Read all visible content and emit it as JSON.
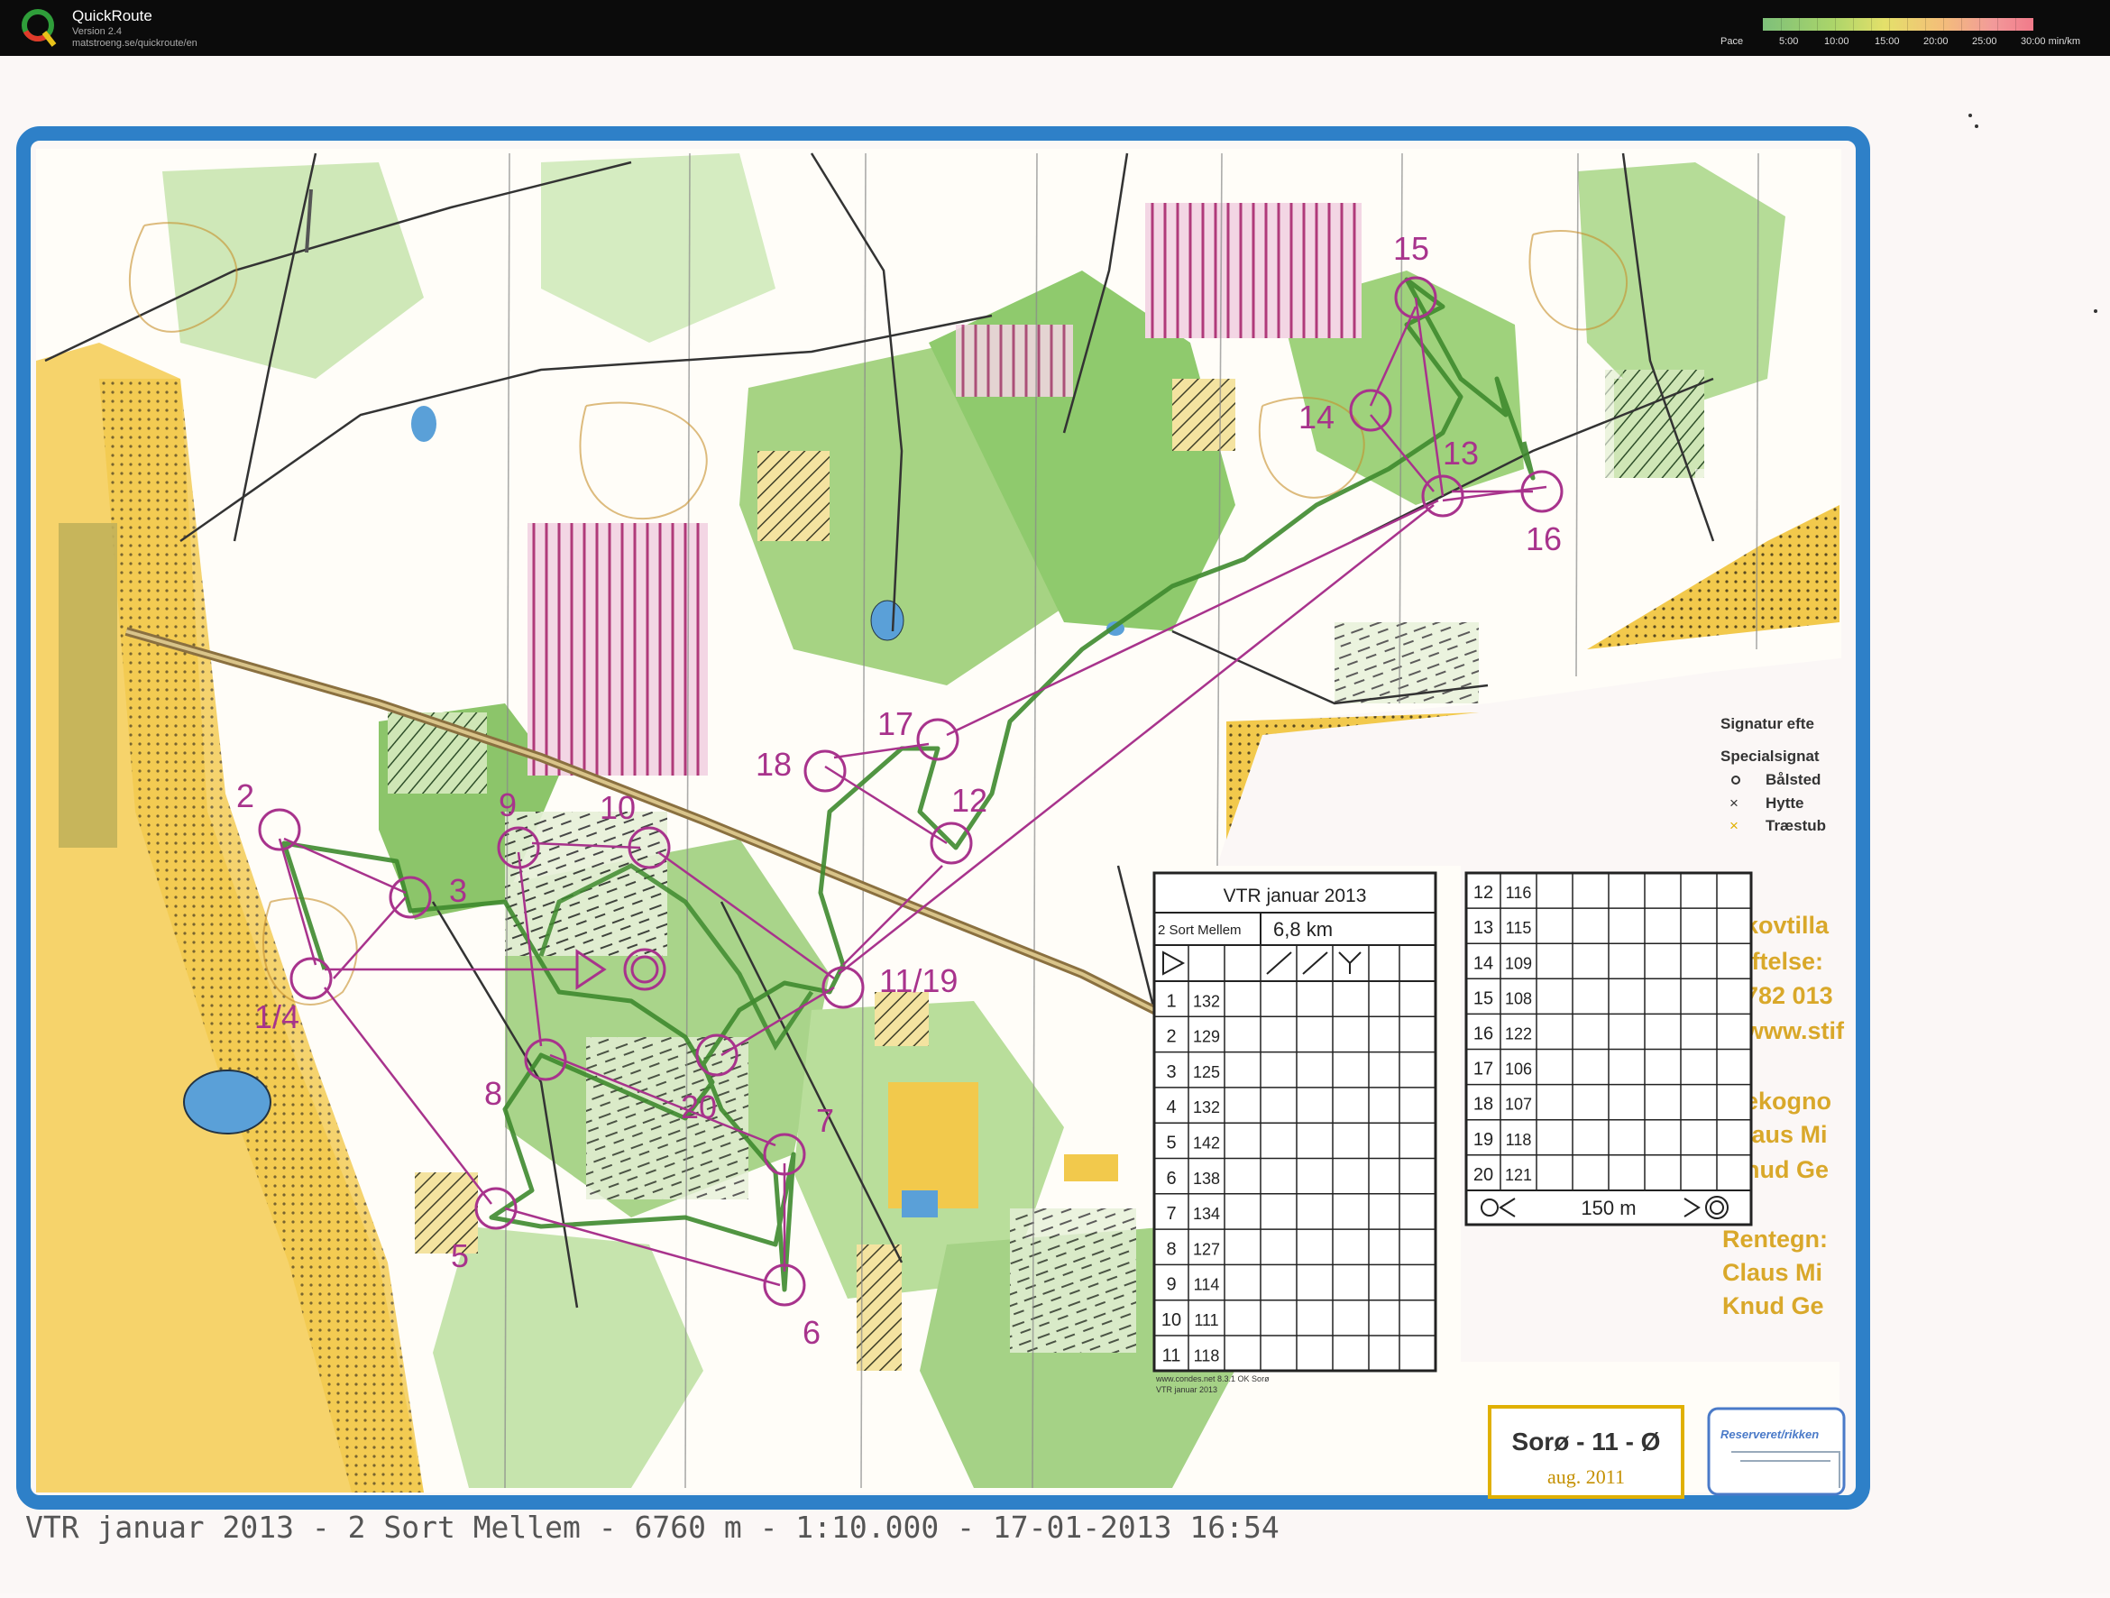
{
  "app": {
    "name": "QuickRoute",
    "version": "Version 2.4",
    "url": "matstroeng.se/quickroute/en"
  },
  "pace": {
    "label": "Pace",
    "ticks": [
      "5:00",
      "10:00",
      "15:00",
      "20:00",
      "25:00",
      "30:00 min/km"
    ]
  },
  "controls": {
    "c2": "2",
    "c3": "3",
    "c14": "1/4",
    "c5": "5",
    "c6": "6",
    "c7": "7",
    "c8": "8",
    "c9": "9",
    "c10": "10",
    "c1119": "11/19",
    "c12": "12",
    "c13": "13",
    "c14b": "14",
    "c15": "15",
    "c16": "16",
    "c17": "17",
    "c18": "18",
    "c20": "20"
  },
  "legend": {
    "title": "Signatur efte",
    "subtitle": "Specialsignat",
    "items": [
      "Bålsted",
      "Hytte",
      "Træstub"
    ]
  },
  "side_text": [
    "kovtilla",
    "iftelse:",
    "782 013",
    "www.stif",
    "ekogno",
    "laus Mi",
    "nud Ge",
    "Rentegn:",
    "Claus Mi",
    "Knud Ge"
  ],
  "descriptions": {
    "title": "VTR januar 2013",
    "class": "2 Sort Mellem",
    "length": "6,8 km",
    "left_rows": [
      [
        "1",
        "132"
      ],
      [
        "2",
        "129"
      ],
      [
        "3",
        "125"
      ],
      [
        "4",
        "132"
      ],
      [
        "5",
        "142"
      ],
      [
        "6",
        "138"
      ],
      [
        "7",
        "134"
      ],
      [
        "8",
        "127"
      ],
      [
        "9",
        "114"
      ],
      [
        "10",
        "111"
      ],
      [
        "11",
        "118"
      ]
    ],
    "right_rows": [
      [
        "12",
        "116"
      ],
      [
        "13",
        "115"
      ],
      [
        "14",
        "109"
      ],
      [
        "15",
        "108"
      ],
      [
        "16",
        "122"
      ],
      [
        "17",
        "106"
      ],
      [
        "18",
        "107"
      ],
      [
        "19",
        "118"
      ],
      [
        "20",
        "121"
      ]
    ],
    "finish_dist": "150 m",
    "credit1": "www.condes.net 8.3.1 OK Sorø",
    "credit2": "VTR januar 2013"
  },
  "mapinfo": {
    "name": "Sorø - 11 - Ø",
    "date": "aug. 2011",
    "reserved": "Reserveret/rikken"
  },
  "caption": "VTR januar 2013 - 2 Sort Mellem - 6760 m - 1:10.000 - 17-01-2013 16:54"
}
